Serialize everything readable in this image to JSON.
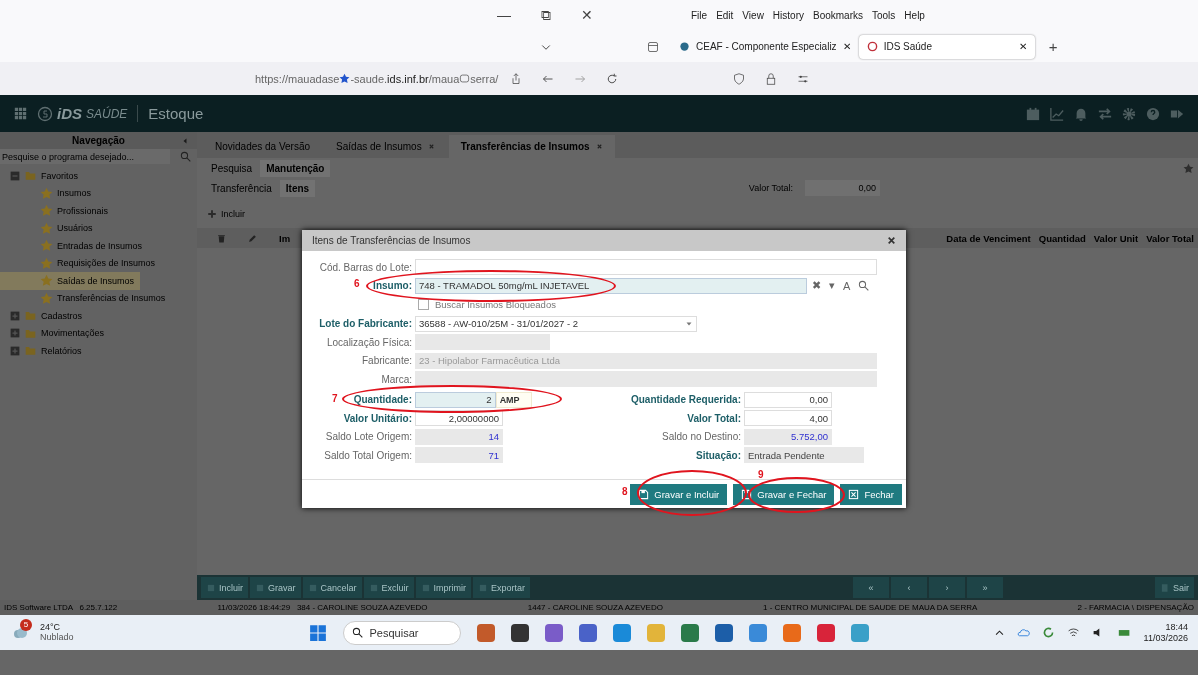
{
  "browser": {
    "window_controls": [
      "—",
      "⧉",
      "✕"
    ],
    "menu": [
      "File",
      "Edit",
      "View",
      "History",
      "Bookmarks",
      "Tools",
      "Help"
    ],
    "tabs": [
      {
        "title": "CEAF - Componente Especializ",
        "selected": false,
        "close": "✕"
      },
      {
        "title": "IDS Saúde",
        "selected": true,
        "close": "✕"
      }
    ],
    "new_tab": "+",
    "url": [
      "https://mauadase",
      "-saude.**ids.inf.br**/maua",
      "serra/"
    ]
  },
  "app": {
    "logo_brand": "iDS",
    "logo_sub": "SAÚDE",
    "module": "Estoque"
  },
  "sidebar": {
    "title": "Navegação",
    "search_placeholder": "Pesquise o programa desejado...",
    "tree": [
      {
        "label": "Favoritos",
        "expanded": true,
        "children": [
          {
            "label": "Insumos",
            "selected": false
          },
          {
            "label": "Profissionais",
            "selected": false
          },
          {
            "label": "Usuários",
            "selected": false
          },
          {
            "label": "Entradas de Insumos",
            "selected": false
          },
          {
            "label": "Requisições de Insumos",
            "selected": false
          },
          {
            "label": "Saídas de Insumos",
            "selected": true
          },
          {
            "label": "Transferências de Insumos",
            "selected": false
          }
        ]
      },
      {
        "label": "Cadastros",
        "expanded": false
      },
      {
        "label": "Movimentações",
        "expanded": false
      },
      {
        "label": "Relatórios",
        "expanded": false
      }
    ]
  },
  "main_tabs": [
    {
      "label": "Novidades da Versão",
      "selected": false,
      "closable": false
    },
    {
      "label": "Saídas de Insumos",
      "selected": false,
      "closable": true
    },
    {
      "label": "Transferências de Insumos",
      "selected": true,
      "closable": true
    }
  ],
  "sub_tabs": [
    {
      "label": "Pesquisa",
      "selected": false
    },
    {
      "label": "Manutenção",
      "selected": true
    }
  ],
  "inner_tabs": [
    {
      "label": "Transferência",
      "selected": false
    },
    {
      "label": "Itens",
      "selected": true
    }
  ],
  "valor_total": {
    "label": "Valor Total:",
    "value": "0,00"
  },
  "include_button": "Incluir",
  "grid": {
    "left_column": "Im",
    "columns": [
      "Data de Venciment",
      "Quantidad",
      "Valor Unit",
      "Valor Total"
    ]
  },
  "dialog": {
    "title": "Itens de Transferências de Insumos",
    "barcode": {
      "label": "Cód. Barras do Lote:"
    },
    "insumo": {
      "label": "Insumo:",
      "value": "748 - TRAMADOL 50mg/mL INJETAVEL",
      "actions": [
        "✖",
        "▾",
        "A"
      ]
    },
    "blocked": {
      "label": "Buscar Insumos Bloqueados",
      "checked": false
    },
    "lote": {
      "label": "Lote do Fabricante:",
      "value": "36588 - AW-010/25M - 31/01/2027 - 2"
    },
    "localizacao": {
      "label": "Localização Física:"
    },
    "fabricante": {
      "label": "Fabricante:",
      "value": "23 - Hipolabor Farmacêutica Ltda"
    },
    "marca": {
      "label": "Marca:"
    },
    "quantidade": {
      "label": "Quantidade:",
      "value": "2",
      "unit": "AMP"
    },
    "pairs": [
      [
        {
          "label": "Valor Unitário:",
          "value": "2,00000000",
          "required": true,
          "readonly": false
        },
        {
          "label": "Valor Total:",
          "value": "4,00",
          "required": true,
          "readonly": false
        }
      ],
      [
        {
          "label": "Saldo Lote Origem:",
          "value": "14",
          "required": false,
          "readonly": true
        },
        {
          "label": "Saldo no Destino:",
          "value": "5.752,00",
          "required": false,
          "readonly": true
        }
      ],
      [
        {
          "label": "Saldo Total Origem:",
          "value": "71",
          "required": false,
          "readonly": true
        },
        {
          "label": "Situação:",
          "value": "Entrada Pendente",
          "required": true,
          "readonly": true
        }
      ]
    ],
    "quantidade_requerida": {
      "label": "Quantidade Requerida:",
      "value": "0,00"
    },
    "buttons": [
      "Gravar e Incluir",
      "Gravar e Fechar",
      "Fechar"
    ],
    "annotations": [
      "6",
      "7",
      "8",
      "9"
    ]
  },
  "toolbar": {
    "buttons": [
      "Incluir",
      "Gravar",
      "Cancelar",
      "Excluir",
      "Imprimir",
      "Exportar"
    ],
    "pager": [
      "«",
      "‹",
      "›",
      "»"
    ],
    "exit": "Sair"
  },
  "status_bar": [
    "IDS Software LTDA   6.25.7.122",
    "11/03/2026 18:44:29   384 - CAROLINE SOUZA AZEVEDO",
    "1447 - CAROLINE SOUZA AZEVEDO",
    "1 - CENTRO MUNICIPAL DE SAUDE DE MAUA DA SERRA",
    "2 - FARMACIA \\ DISPENSAÇÃO"
  ],
  "taskbar": {
    "weather_badge": "5",
    "temperature": "24°C",
    "weather": "Nublado",
    "search_placeholder": "Pesquisar",
    "time": "18:44",
    "date": "11/03/2026"
  }
}
